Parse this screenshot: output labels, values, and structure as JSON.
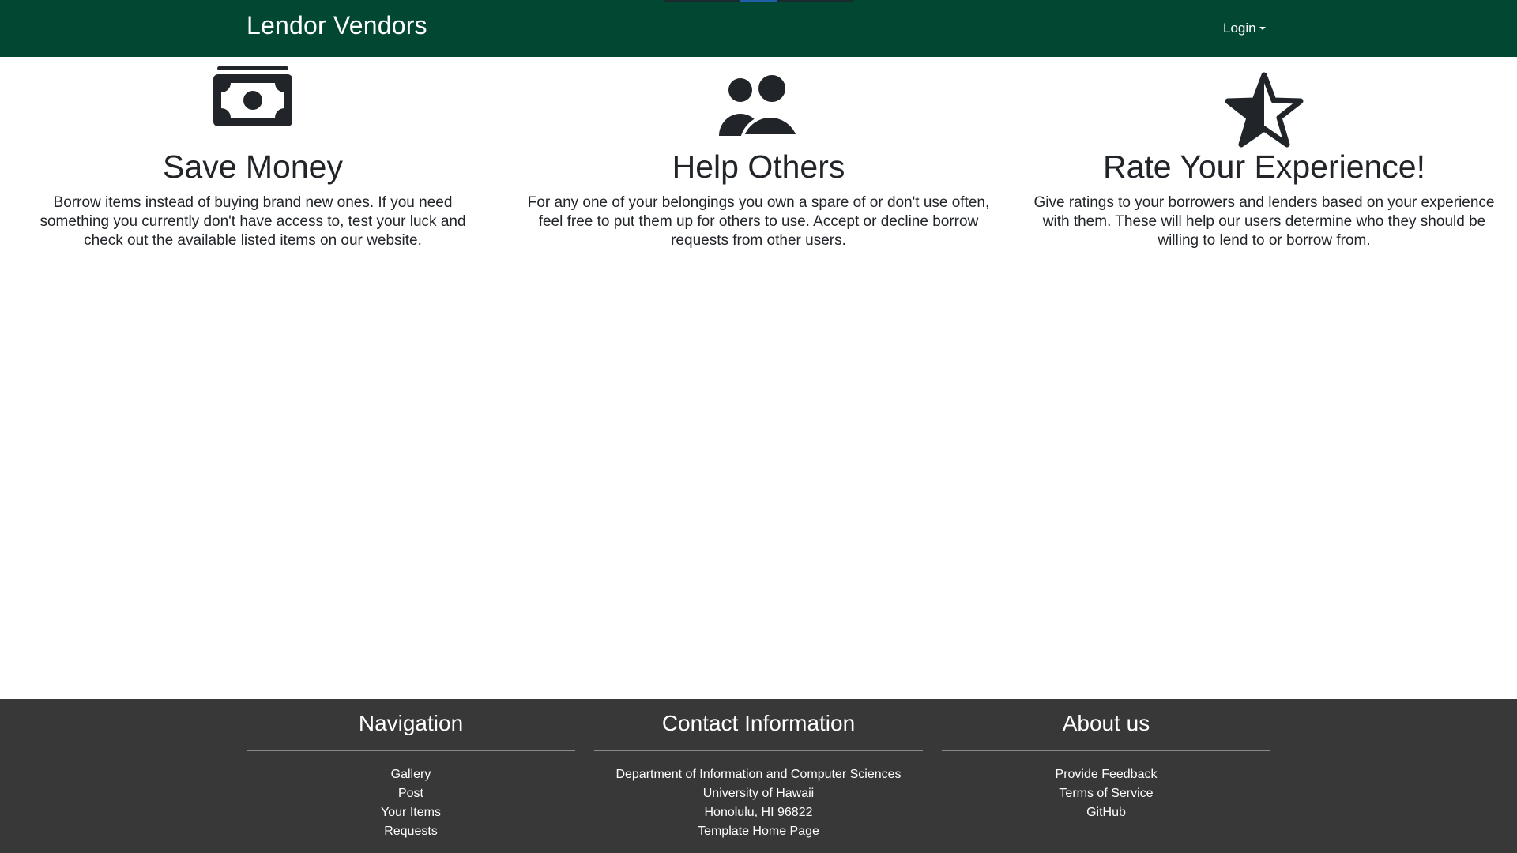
{
  "navbar": {
    "brand": "Lendor Vendors",
    "login_label": "Login"
  },
  "features": [
    {
      "icon": "money-bill-icon",
      "title": "Save Money",
      "text": "Borrow items instead of buying brand new ones. If you need something you currently don't have access to, test your luck and check out the available listed items on our website."
    },
    {
      "icon": "users-icon",
      "title": "Help Others",
      "text": "For any one of your belongings you own a spare of or don't use often, feel free to put them up for others to use. Accept or decline borrow requests from other users."
    },
    {
      "icon": "star-half-icon",
      "title": "Rate Your Experience!",
      "text": "Give ratings to your borrowers and lenders based on your experience with them. These will help our users determine who they should be willing to lend to or borrow from."
    }
  ],
  "footer": {
    "navigation": {
      "title": "Navigation",
      "links": [
        "Gallery",
        "Post",
        "Your Items",
        "Requests"
      ]
    },
    "contact": {
      "title": "Contact Information",
      "lines": [
        "Department of Information and Computer Sciences",
        "University of Hawaii",
        "Honolulu, HI 96822",
        "Template Home Page"
      ]
    },
    "about": {
      "title": "About us",
      "links": [
        "Provide Feedback",
        "Terms of Service",
        "GitHub"
      ]
    }
  },
  "colors": {
    "navbar_bg": "#024731",
    "footer_bg": "#383838",
    "text": "#212529"
  }
}
